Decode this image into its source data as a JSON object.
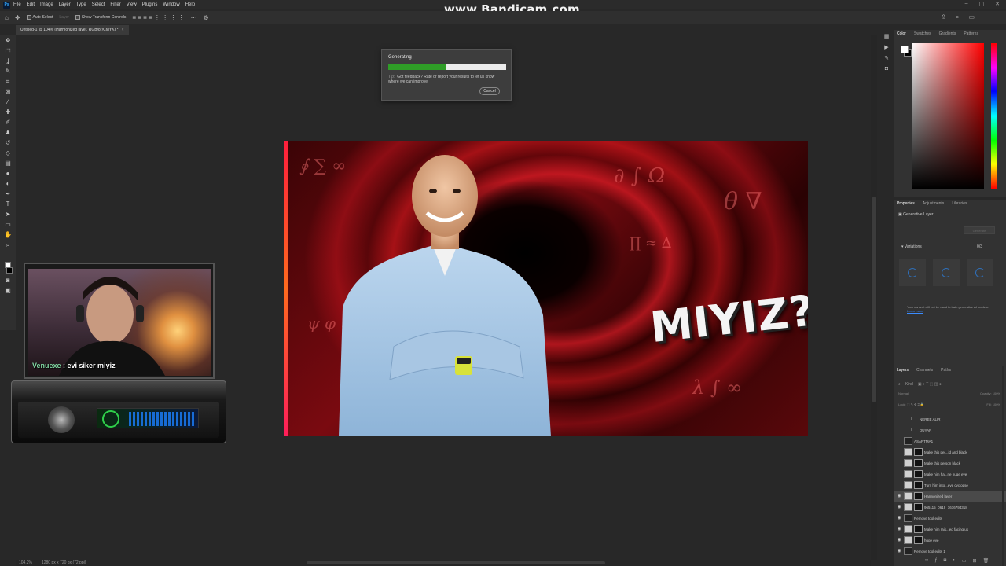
{
  "app": {
    "logo": "Ps"
  },
  "watermark": "www.Bandicam.com",
  "menu": [
    "File",
    "Edit",
    "Image",
    "Layer",
    "Type",
    "Select",
    "Filter",
    "View",
    "Plugins",
    "Window",
    "Help"
  ],
  "options_bar": {
    "auto_select": "Auto-Select",
    "layer_dropdown": "Layer",
    "transform_controls": "Show Transform Controls"
  },
  "document_tab": {
    "title": "Untitled-1 @ 104% (Harmonized layer, RGB/8*/CMYK) *",
    "close": "×"
  },
  "status": {
    "zoom": "104.2%",
    "dimensions": "1280 px x 720 px (72 ppi)"
  },
  "artwork": {
    "headline": "MIYIZ?"
  },
  "generating_dialog": {
    "title": "Generating",
    "progress": 0.49,
    "tip_label": "Tip:",
    "tip": "Got feedback? Rate or report your results to let us know where we can improve.",
    "cancel": "Cancel"
  },
  "overlay": {
    "chat_user": "Venuexe",
    "chat_message": " : evi siker miyiz"
  },
  "color_panel": {
    "tabs": [
      "Color",
      "Swatches",
      "Gradients",
      "Patterns"
    ]
  },
  "properties_panel": {
    "tabs": [
      "Properties",
      "Adjustments",
      "Libraries"
    ],
    "layer_type": "Generative Layer",
    "generate_button": "Generate",
    "variations_label": "Variations",
    "variations_count": "0/3",
    "note": "Your content will not be used to train generative AI models.",
    "note_link": "Learn more"
  },
  "layers_panel": {
    "tabs": [
      "Layers",
      "Channels",
      "Paths"
    ],
    "kind_filter": "Kind",
    "blend_mode": "Normal",
    "opacity_label": "Opacity:",
    "opacity_value": "100%",
    "lock_label": "Lock:",
    "fill_label": "Fill:",
    "fill_value": "100%",
    "layers": [
      {
        "name": "NEREE ALIR",
        "kind": "text",
        "visible": false,
        "selected": false
      },
      {
        "name": "DUYAR",
        "kind": "text",
        "visible": false,
        "selected": false
      },
      {
        "name": "ASARTMA1",
        "kind": "smart",
        "visible": false,
        "selected": false
      },
      {
        "name": "Make this per...id and black",
        "kind": "gen",
        "visible": false,
        "selected": false
      },
      {
        "name": "Make this person black",
        "kind": "gen",
        "visible": false,
        "selected": false
      },
      {
        "name": "Make him ha...ne huge eye",
        "kind": "gen",
        "visible": false,
        "selected": false
      },
      {
        "name": "Turn him into...eye cyclopse",
        "kind": "gen",
        "visible": false,
        "selected": false
      },
      {
        "name": "Harmonized layer",
        "kind": "gen",
        "visible": true,
        "selected": true
      },
      {
        "name": "965115_0619_1616794318",
        "kind": "gen",
        "visible": true,
        "selected": false
      },
      {
        "name": "Remove tool edits",
        "kind": "smart",
        "visible": true,
        "selected": false
      },
      {
        "name": "Make him rais...ed facing us",
        "kind": "gen",
        "visible": true,
        "selected": false
      },
      {
        "name": "huge eye",
        "kind": "gen",
        "visible": true,
        "selected": false
      },
      {
        "name": "Remove tool edits 1",
        "kind": "smart",
        "visible": true,
        "selected": false
      }
    ]
  }
}
